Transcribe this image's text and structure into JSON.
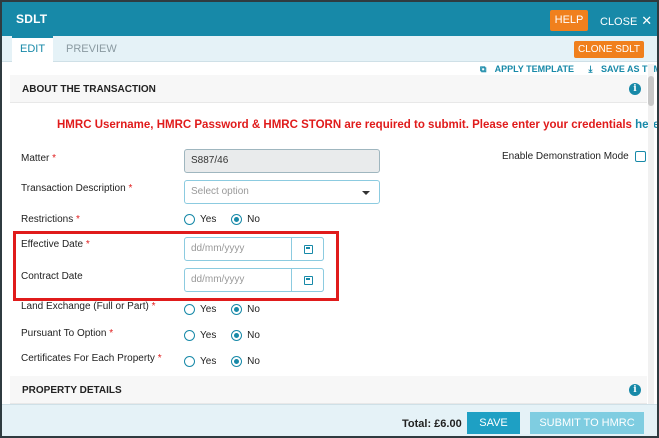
{
  "window": {
    "title": "SDLT",
    "help_label": "HELP",
    "close_label": "CLOSE"
  },
  "tabs": [
    {
      "label": "EDIT",
      "active": true
    },
    {
      "label": "PREVIEW",
      "active": false
    }
  ],
  "clone_label": "CLONE SDLT",
  "templates": {
    "apply_label": "APPLY TEMPLATE",
    "save_label": "SAVE AS TEMPLATE"
  },
  "sections": {
    "transaction_title": "ABOUT THE TRANSACTION",
    "property_title": "PROPERTY DETAILS"
  },
  "warning": {
    "text": "HMRC Username, HMRC Password & HMRC STORN are required to submit. Please enter your credentials",
    "link": "here"
  },
  "demo_mode_label": "Enable Demonstration Mode",
  "fields": {
    "matter": {
      "label": "Matter",
      "value": "S887/46"
    },
    "transaction_description": {
      "label": "Transaction Description",
      "placeholder": "Select option"
    },
    "restrictions": {
      "label": "Restrictions",
      "selected": "No"
    },
    "effective_date": {
      "label": "Effective Date",
      "placeholder": "dd/mm/yyyy"
    },
    "contract_date": {
      "label": "Contract Date",
      "placeholder": "dd/mm/yyyy"
    },
    "land_exchange": {
      "label": "Land Exchange (Full or Part)",
      "selected": "No"
    },
    "pursuant_to_option": {
      "label": "Pursuant To Option",
      "selected": "No"
    },
    "certificates": {
      "label": "Certificates For Each Property",
      "selected": "No"
    }
  },
  "radio_options": {
    "yes": "Yes",
    "no": "No"
  },
  "required_mark": "*",
  "footer": {
    "total_label": "Total: £6.00",
    "save_label": "SAVE",
    "submit_label": "SUBMIT TO HMRC"
  },
  "colors": {
    "primary": "#1789a8",
    "accent": "#f0801d",
    "warning": "#e01b1b"
  }
}
